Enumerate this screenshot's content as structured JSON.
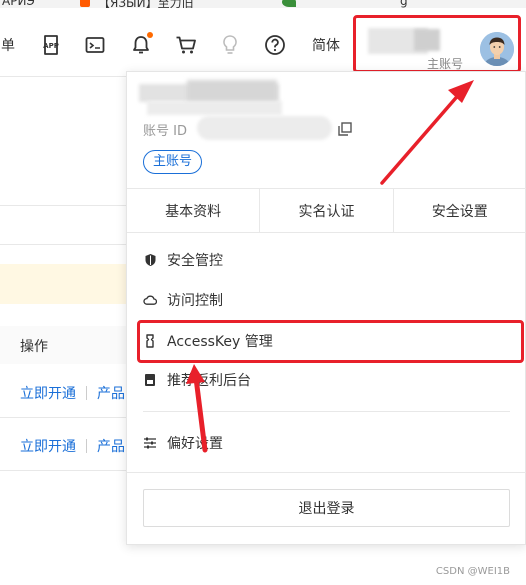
{
  "tabstrip": {
    "tab1": "АРИЭ",
    "tab2": "【ЯЗЫЙ】至力旧",
    "tab3": "g"
  },
  "nav": {
    "partial_item": "单",
    "simplified": "简体"
  },
  "account": {
    "type_label": "主账号"
  },
  "dropdown": {
    "account_id_label": "账号 ID",
    "badge": "主账号",
    "tabs": [
      "基本资料",
      "实名认证",
      "安全设置"
    ],
    "menu": [
      {
        "label": "安全管控",
        "icon": "shield-icon"
      },
      {
        "label": "访问控制",
        "icon": "cloud-icon"
      },
      {
        "label": "AccessKey 管理",
        "icon": "key-icon"
      },
      {
        "label": "推荐返利后台",
        "icon": "gift-icon"
      },
      {
        "label": "偏好设置",
        "icon": "sliders-icon"
      }
    ],
    "logout": "退出登录"
  },
  "page": {
    "column_header": "操作",
    "rows": [
      {
        "action": "立即开通",
        "more": "产品"
      },
      {
        "action": "立即开通",
        "more": "产品"
      }
    ]
  },
  "watermark": "CSDN @WEI1B",
  "colors": {
    "accent": "#1a6fd8",
    "annotation": "#e8202a",
    "notification": "#ff6a00"
  }
}
